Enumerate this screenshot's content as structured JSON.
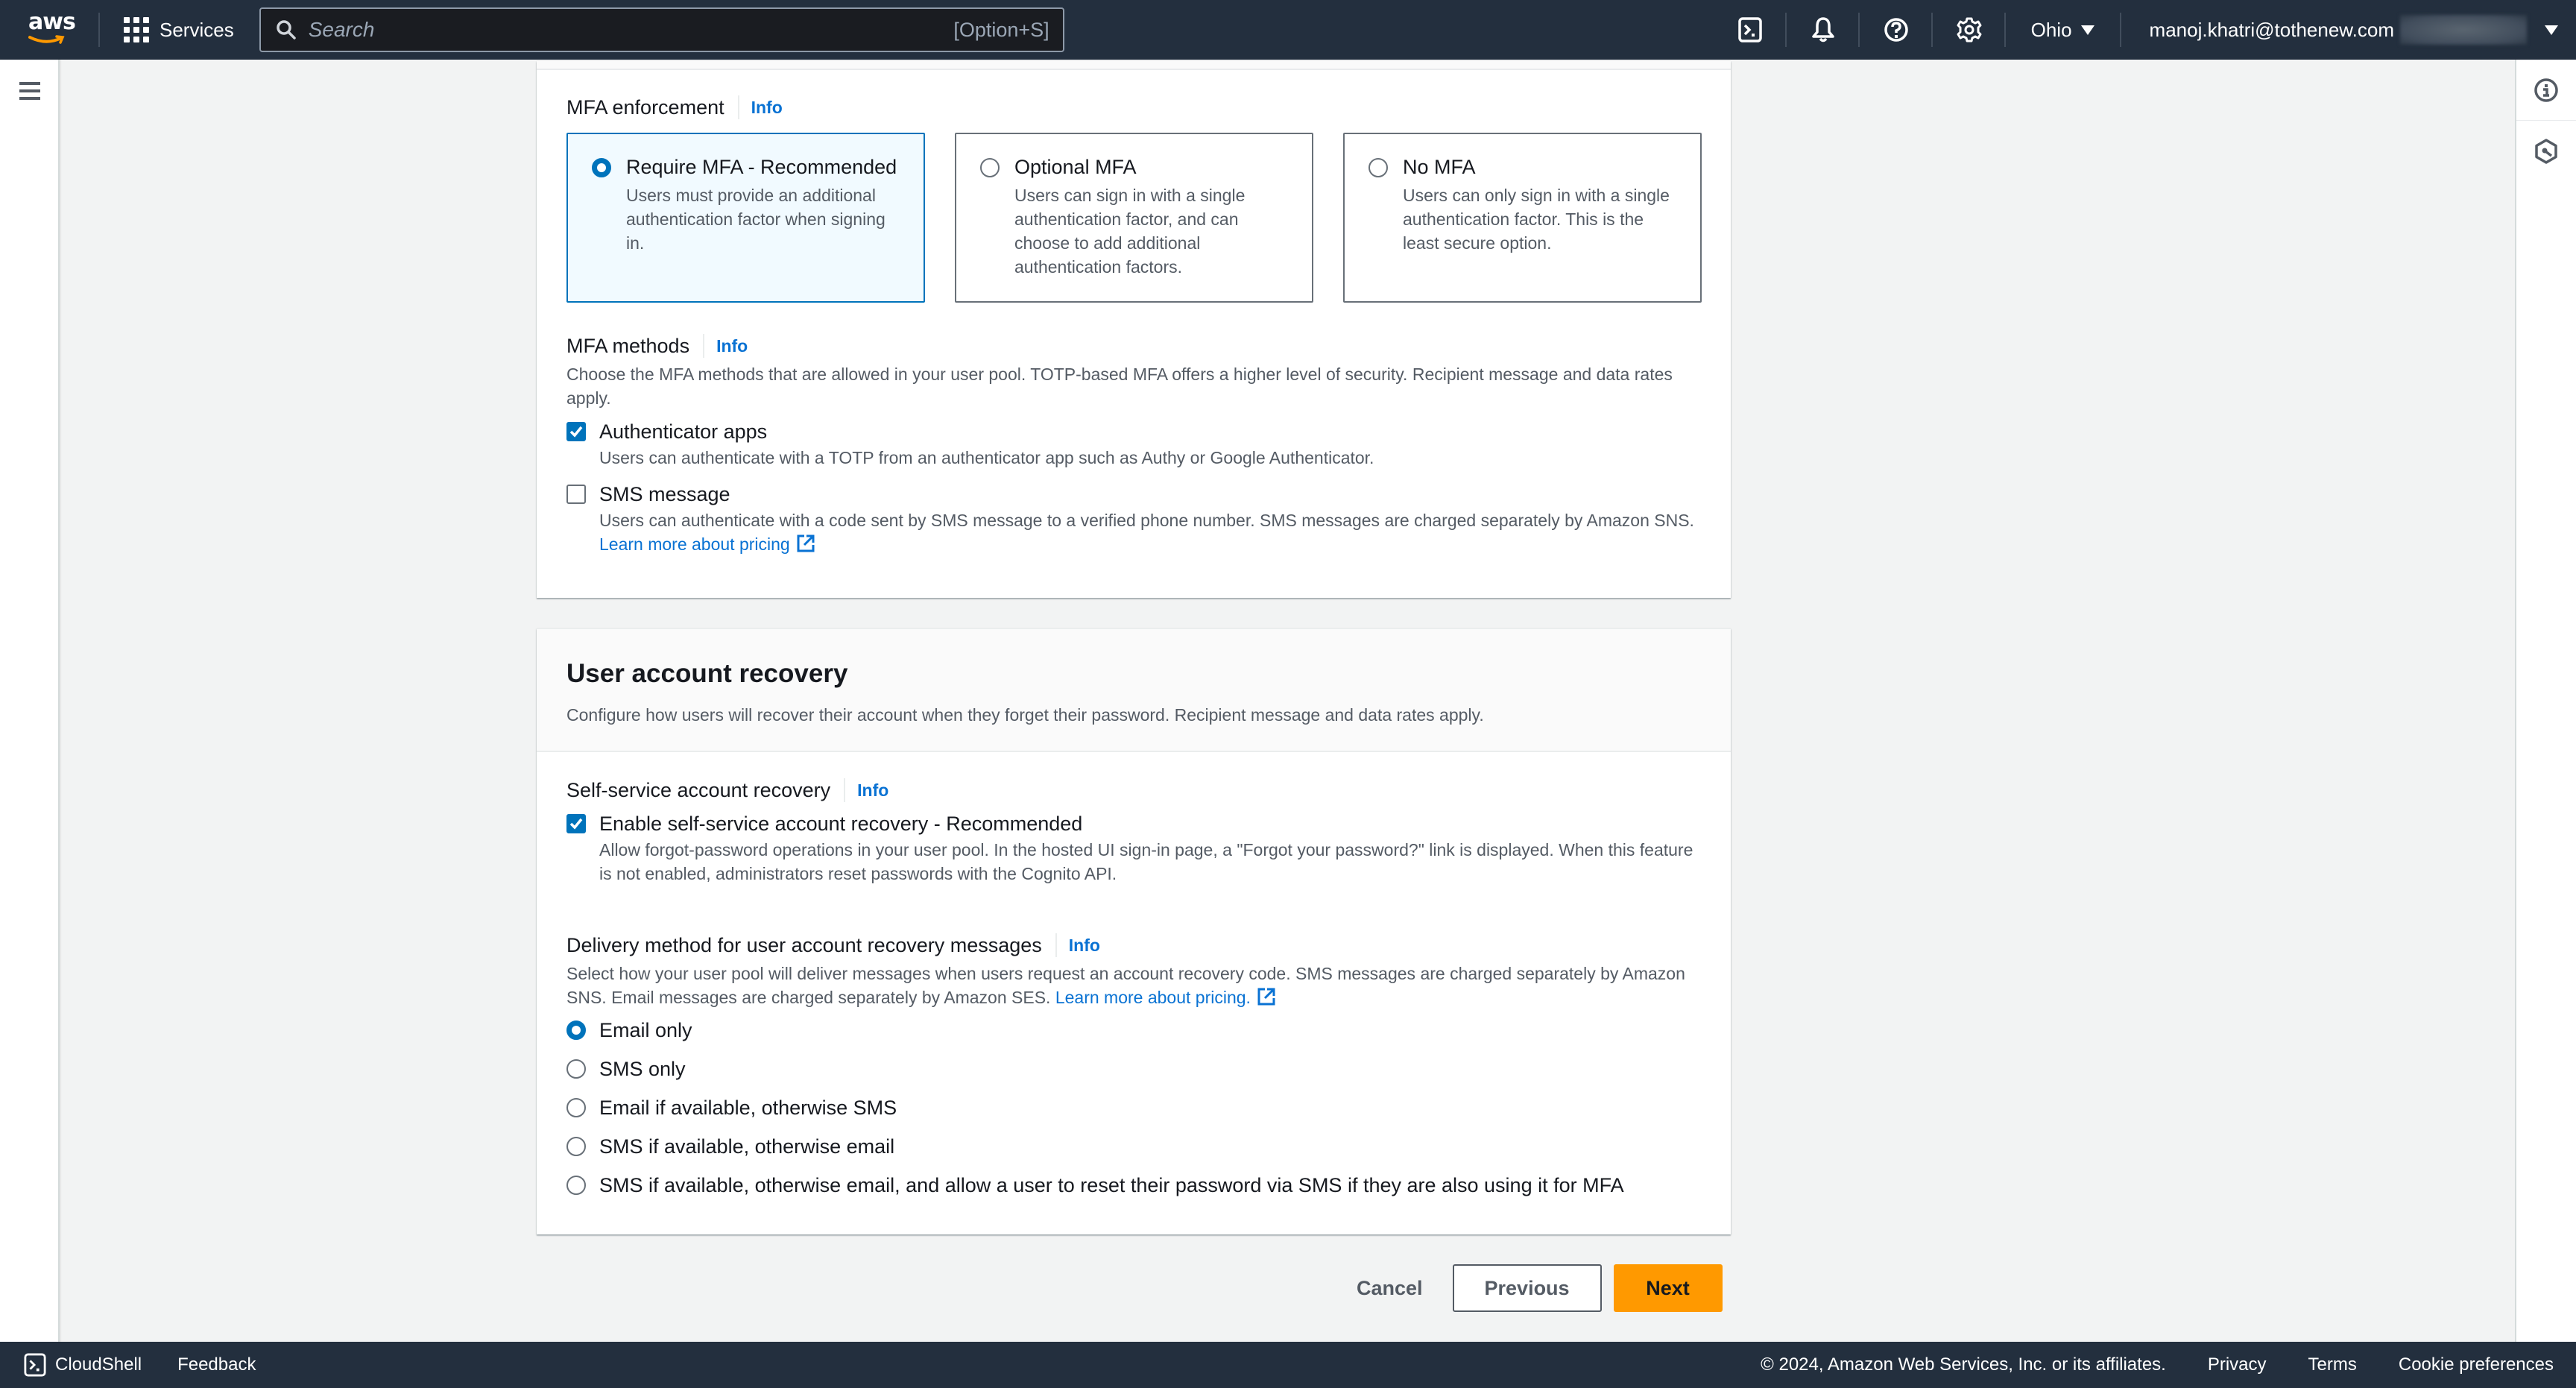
{
  "topnav": {
    "logo_text": "aws",
    "services_label": "Services",
    "search_placeholder": "Search",
    "search_shortcut": "[Option+S]",
    "icons": [
      "cloudshell-icon",
      "notifications-bell-icon",
      "help-icon",
      "settings-gear-icon"
    ],
    "region": "Ohio",
    "account_email": "manoj.khatri@tothenew.com"
  },
  "mfa": {
    "enforcement_label": "MFA enforcement",
    "info": "Info",
    "options": [
      {
        "title": "Require MFA - Recommended",
        "desc": "Users must provide an additional authentication factor when signing in.",
        "selected": true
      },
      {
        "title": "Optional MFA",
        "desc": "Users can sign in with a single authentication factor, and can choose to add additional authentication factors.",
        "selected": false
      },
      {
        "title": "No MFA",
        "desc": "Users can only sign in with a single authentication factor. This is the least secure option.",
        "selected": false
      }
    ],
    "methods_label": "MFA methods",
    "methods_desc": "Choose the MFA methods that are allowed in your user pool. TOTP-based MFA offers a higher level of security. Recipient message and data rates apply.",
    "methods": [
      {
        "title": "Authenticator apps",
        "desc": "Users can authenticate with a TOTP from an authenticator app such as Authy or Google Authenticator.",
        "checked": true
      },
      {
        "title": "SMS message",
        "desc": "Users can authenticate with a code sent by SMS message to a verified phone number. SMS messages are charged separately by Amazon SNS.",
        "link": "Learn more about pricing",
        "checked": false
      }
    ]
  },
  "recovery": {
    "title": "User account recovery",
    "desc": "Configure how users will recover their account when they forget their password. Recipient message and data rates apply.",
    "self_service_label": "Self-service account recovery",
    "info": "Info",
    "self_service_option": {
      "title": "Enable self-service account recovery - Recommended",
      "desc": "Allow forgot-password operations in your user pool. In the hosted UI sign-in page, a \"Forgot your password?\" link is displayed. When this feature is not enabled, administrators reset passwords with the Cognito API.",
      "checked": true
    },
    "delivery_label": "Delivery method for user account recovery messages",
    "delivery_desc": "Select how your user pool will deliver messages when users request an account recovery code. SMS messages are charged separately by Amazon SNS. Email messages are charged separately by Amazon SES.",
    "delivery_link": "Learn more about pricing.",
    "delivery_options": [
      {
        "label": "Email only",
        "selected": true
      },
      {
        "label": "SMS only",
        "selected": false
      },
      {
        "label": "Email if available, otherwise SMS",
        "selected": false
      },
      {
        "label": "SMS if available, otherwise email",
        "selected": false
      },
      {
        "label": "SMS if available, otherwise email, and allow a user to reset their password via SMS if they are also using it for MFA",
        "selected": false
      }
    ]
  },
  "actions": {
    "cancel": "Cancel",
    "previous": "Previous",
    "next": "Next"
  },
  "footer": {
    "cloudshell": "CloudShell",
    "feedback": "Feedback",
    "copyright": "© 2024, Amazon Web Services, Inc. or its affiliates.",
    "privacy": "Privacy",
    "terms": "Terms",
    "cookie": "Cookie preferences"
  },
  "colors": {
    "nav_bg": "#232f3e",
    "accent_blue": "#0073bb",
    "link_blue": "#0972d3",
    "primary_orange": "#ff9900",
    "page_bg": "#f2f3f3"
  }
}
